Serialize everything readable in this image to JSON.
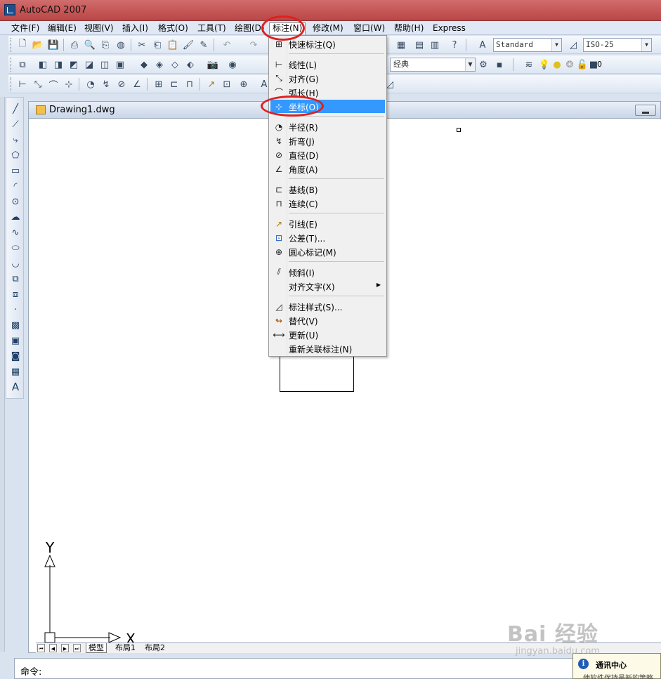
{
  "window": {
    "title": "AutoCAD 2007"
  },
  "menubar": {
    "items": [
      "文件(F)",
      "编辑(E)",
      "视图(V)",
      "插入(I)",
      "格式(O)",
      "工具(T)",
      "绘图(D)",
      "标注(N)",
      "修改(M)",
      "窗口(W)",
      "帮助(H)",
      "Express"
    ]
  },
  "toolbar": {
    "text_style": "Standard",
    "dim_style": "ISO-25",
    "workspace": "经典",
    "layer": "0"
  },
  "dimension_menu": {
    "items": [
      {
        "label": "快速标注(Q)",
        "icon": "quick-dimension-icon"
      },
      {
        "label": "线性(L)",
        "icon": "linear-icon"
      },
      {
        "label": "对齐(G)",
        "icon": "aligned-icon"
      },
      {
        "label": "弧长(H)",
        "icon": "arc-length-icon"
      },
      {
        "label": "坐标(O)",
        "icon": "ordinate-icon",
        "highlighted": true
      },
      {
        "label": "半径(R)",
        "icon": "radius-icon"
      },
      {
        "label": "折弯(J)",
        "icon": "jogged-icon"
      },
      {
        "label": "直径(D)",
        "icon": "diameter-icon"
      },
      {
        "label": "角度(A)",
        "icon": "angular-icon"
      },
      {
        "label": "基线(B)",
        "icon": "baseline-icon"
      },
      {
        "label": "连续(C)",
        "icon": "continue-icon"
      },
      {
        "label": "引线(E)",
        "icon": "leader-icon"
      },
      {
        "label": "公差(T)...",
        "icon": "tolerance-icon"
      },
      {
        "label": "圆心标记(M)",
        "icon": "center-mark-icon"
      },
      {
        "label": "倾斜(I)",
        "icon": "oblique-icon"
      },
      {
        "label": "对齐文字(X)",
        "icon": "",
        "submenu": true
      },
      {
        "label": "标注样式(S)...",
        "icon": "dimension-style-icon"
      },
      {
        "label": "替代(V)",
        "icon": "override-icon"
      },
      {
        "label": "更新(U)",
        "icon": "update-icon"
      },
      {
        "label": "重新关联标注(N)",
        "icon": ""
      }
    ]
  },
  "drawing": {
    "title": "Drawing1.dwg",
    "ucs_x": "X",
    "ucs_y": "Y"
  },
  "layout_tabs": [
    "模型",
    "布局1",
    "布局2"
  ],
  "command": {
    "prompt": "命令:"
  },
  "notification": {
    "title": "通讯中心",
    "text": "使软件保持最新的策略"
  },
  "watermark": {
    "main": "Bai 经验",
    "sub": "jingyan.baidu.com"
  },
  "colors": {
    "title_bar": "#c85a5a",
    "highlight": "#3399ff",
    "annotation": "#e02020"
  }
}
